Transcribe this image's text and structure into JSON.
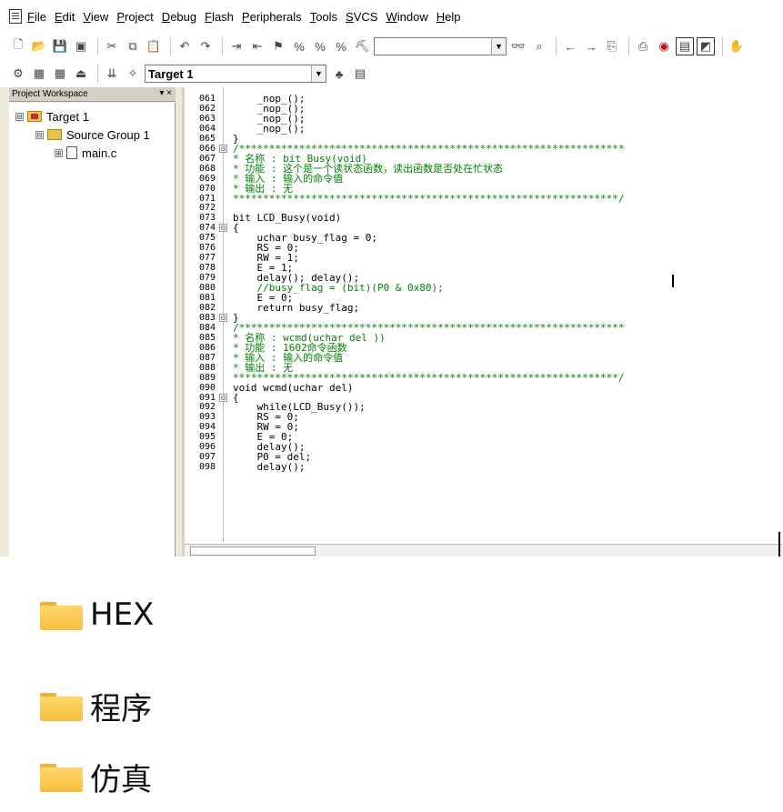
{
  "menu": [
    {
      "label": "File"
    },
    {
      "label": "Edit"
    },
    {
      "label": "View"
    },
    {
      "label": "Project"
    },
    {
      "label": "Debug"
    },
    {
      "label": "Flash"
    },
    {
      "label": "Peripherals"
    },
    {
      "label": "Tools"
    },
    {
      "label": "SVCS"
    },
    {
      "label": "Window"
    },
    {
      "label": "Help"
    }
  ],
  "toolbar2": {
    "target_select": "Target 1"
  },
  "project_workspace": {
    "title": "Project Workspace",
    "controls": "▾ ×",
    "tree": [
      {
        "label": "Target 1",
        "expander": "⊟"
      },
      {
        "label": "Source Group 1",
        "expander": "⊟"
      },
      {
        "label": "main.c",
        "expander": "⊞"
      }
    ]
  },
  "editor": {
    "lines": [
      {
        "n": "061",
        "t": "    _nop_();",
        "c": false,
        "f": ""
      },
      {
        "n": "062",
        "t": "    _nop_();",
        "c": false,
        "f": ""
      },
      {
        "n": "063",
        "t": "    _nop_();",
        "c": false,
        "f": ""
      },
      {
        "n": "064",
        "t": "    _nop_();",
        "c": false,
        "f": ""
      },
      {
        "n": "065",
        "t": "}",
        "c": false,
        "f": ""
      },
      {
        "n": "066",
        "t": "/****************************************************************",
        "c": true,
        "f": "⊟"
      },
      {
        "n": "067",
        "t": "* 名称 : bit Busy(void)",
        "c": true,
        "f": ""
      },
      {
        "n": "068",
        "t": "* 功能 : 这个是一个读状态函数，读出函数是否处在忙状态",
        "c": true,
        "f": ""
      },
      {
        "n": "069",
        "t": "* 输入 : 输入的命令值",
        "c": true,
        "f": ""
      },
      {
        "n": "070",
        "t": "* 输出 : 无",
        "c": true,
        "f": ""
      },
      {
        "n": "071",
        "t": "****************************************************************/",
        "c": true,
        "f": ""
      },
      {
        "n": "072",
        "t": "",
        "c": false,
        "f": ""
      },
      {
        "n": "073",
        "t": "bit LCD_Busy(void)",
        "c": false,
        "f": ""
      },
      {
        "n": "074",
        "t": "{",
        "c": false,
        "f": "⊟"
      },
      {
        "n": "075",
        "t": "    uchar busy_flag = 0;",
        "c": false,
        "f": ""
      },
      {
        "n": "076",
        "t": "    RS = 0;",
        "c": false,
        "f": ""
      },
      {
        "n": "077",
        "t": "    RW = 1;",
        "c": false,
        "f": ""
      },
      {
        "n": "078",
        "t": "    E = 1;",
        "c": false,
        "f": ""
      },
      {
        "n": "079",
        "t": "    delay(); delay();",
        "c": false,
        "f": ""
      },
      {
        "n": "080",
        "t": "    //busy_flag = (bit)(P0 & 0x80);",
        "c": true,
        "f": ""
      },
      {
        "n": "081",
        "t": "    E = 0;",
        "c": false,
        "f": ""
      },
      {
        "n": "082",
        "t": "    return busy_flag;",
        "c": false,
        "f": ""
      },
      {
        "n": "083",
        "t": "}",
        "c": false,
        "f": "⊟"
      },
      {
        "n": "084",
        "t": "/****************************************************************",
        "c": true,
        "f": ""
      },
      {
        "n": "085",
        "t": "* 名称 : wcmd(uchar del ))",
        "c": true,
        "f": ""
      },
      {
        "n": "086",
        "t": "* 功能 : 1602命令函数",
        "c": true,
        "f": ""
      },
      {
        "n": "087",
        "t": "* 输入 : 输入的命令值",
        "c": true,
        "f": ""
      },
      {
        "n": "088",
        "t": "* 输出 : 无",
        "c": true,
        "f": ""
      },
      {
        "n": "089",
        "t": "****************************************************************/",
        "c": true,
        "f": ""
      },
      {
        "n": "090",
        "t": "void wcmd(uchar del)",
        "c": false,
        "f": ""
      },
      {
        "n": "091",
        "t": "{",
        "c": false,
        "f": "⊟"
      },
      {
        "n": "092",
        "t": "    while(LCD_Busy());",
        "c": false,
        "f": ""
      },
      {
        "n": "093",
        "t": "    RS = 0;",
        "c": false,
        "f": ""
      },
      {
        "n": "094",
        "t": "    RW = 0;",
        "c": false,
        "f": ""
      },
      {
        "n": "095",
        "t": "    E = 0;",
        "c": false,
        "f": ""
      },
      {
        "n": "096",
        "t": "    delay();",
        "c": false,
        "f": ""
      },
      {
        "n": "097",
        "t": "    P0 = del;",
        "c": false,
        "f": ""
      },
      {
        "n": "098",
        "t": "    delay();",
        "c": false,
        "f": ""
      }
    ]
  },
  "folders": [
    {
      "name": "HEX"
    },
    {
      "name": "程序"
    },
    {
      "name": "仿真"
    }
  ],
  "icons": {
    "toolbar1": [
      "new-file-icon",
      "open-icon",
      "save-icon",
      "save-all-icon",
      "cut-icon",
      "copy-icon",
      "paste-icon",
      "undo-icon",
      "redo-icon",
      "indent-icon",
      "outdent-icon",
      "bookmark-icon",
      "prev-bookmark-icon",
      "next-bookmark-icon",
      "clear-bookmark-icon",
      "find-in-files-icon",
      "binoculars-icon",
      "find-icon",
      "back-icon",
      "forward-icon",
      "insert-icon",
      "print-icon",
      "debug-icon",
      "window-icon",
      "window2-icon",
      "hand-icon"
    ],
    "toolbar2": [
      "build-icon",
      "translate-icon",
      "rebuild-icon",
      "stop-build-icon",
      "download-icon",
      "wizard-icon",
      "target-options-icon",
      "manage-components-icon"
    ]
  },
  "colors": {
    "comment": "#008000",
    "folder": "#f4bf3f"
  }
}
